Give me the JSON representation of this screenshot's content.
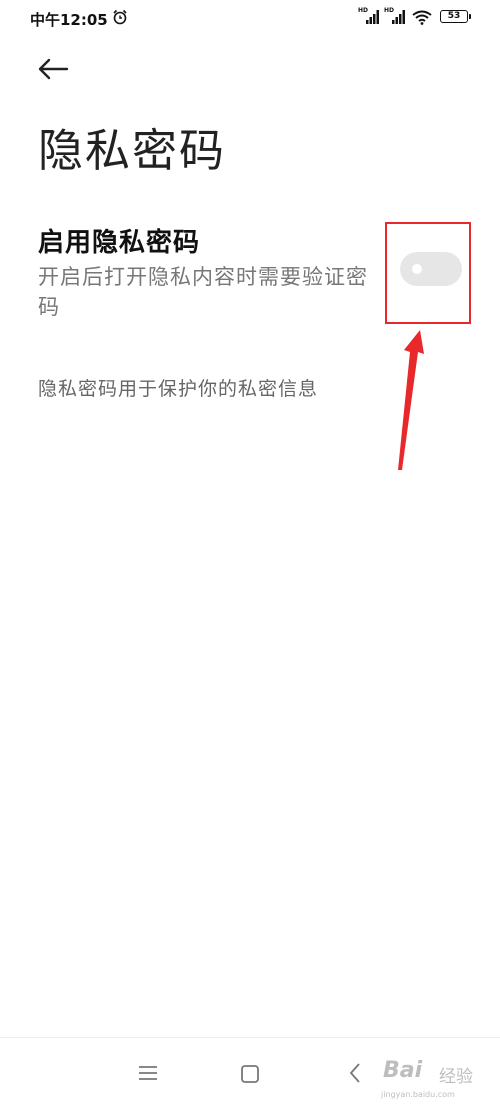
{
  "status_bar": {
    "time": "中午12:05",
    "signal1_label": "HD",
    "signal2_label": "HD",
    "battery": "53"
  },
  "header": {
    "title": "隐私密码"
  },
  "setting": {
    "title": "启用隐私密码",
    "description": "开启后打开隐私内容时需要验证密码",
    "toggle_on": false
  },
  "footer_note": "隐私密码用于保护你的私密信息",
  "watermark": {
    "brand": "Bai",
    "brand_cn": "经验",
    "url": "jingyan.baidu.com"
  },
  "colors": {
    "annotation": "#e8282b",
    "toggle_off": "#e6e6e6"
  },
  "icons": [
    "alarm-icon",
    "signal-icon",
    "wifi-icon",
    "battery-icon",
    "back-arrow-icon",
    "menu-icon",
    "home-icon",
    "back-icon"
  ]
}
